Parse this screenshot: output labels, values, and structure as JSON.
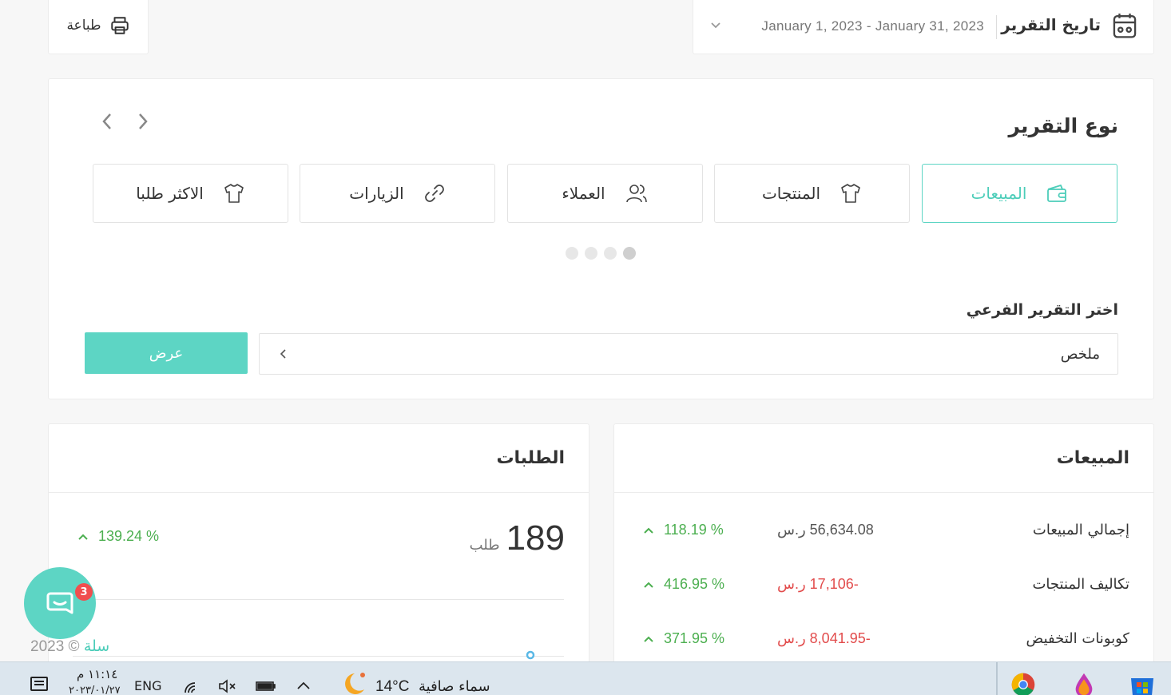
{
  "toolbar": {
    "print_label": "طباعة"
  },
  "date_filter": {
    "title": "تاريخ التقرير",
    "range": "January 1, 2023 - January 31, 2023"
  },
  "report_type": {
    "heading": "نوع التقرير",
    "tiles": [
      {
        "label": "المبيعات",
        "icon": "wallet-icon",
        "active": true
      },
      {
        "label": "المنتجات",
        "icon": "shirt-icon",
        "active": false
      },
      {
        "label": "العملاء",
        "icon": "users-icon",
        "active": false
      },
      {
        "label": "الزيارات",
        "icon": "link-icon",
        "active": false
      },
      {
        "label": "الاكثر طلبا",
        "icon": "shirt-icon",
        "active": false
      }
    ],
    "active_page": 4,
    "page_count": 4
  },
  "sub_report": {
    "label": "اختر التقرير الفرعي",
    "value": "ملخص",
    "show_button": "عرض"
  },
  "sales": {
    "title": "المبيعات",
    "rows": [
      {
        "label": "إجمالي المبيعات",
        "amount": "56,634.08 ر.س",
        "negative": false,
        "change": "118.19 %"
      },
      {
        "label": "تكاليف المنتجات",
        "amount": "-17,106 ر.س",
        "negative": true,
        "change": "416.95 %"
      },
      {
        "label": "كوبونات التخفيض",
        "amount": "-8,041.95 ر.س",
        "negative": true,
        "change": "371.95 %"
      }
    ]
  },
  "orders": {
    "title": "الطلبات",
    "count": "189",
    "unit": "طلب",
    "change": "139.24 %"
  },
  "chat": {
    "badge": "3"
  },
  "footer": {
    "copyright": "2023 ©",
    "brand": "سلة"
  },
  "taskbar": {
    "weather_text": "سماء صافية",
    "temperature": "14°C",
    "language": "ENG",
    "time": "١١:١٤ م",
    "date": "٢٠٢٣/٠١/٢٧"
  },
  "colors": {
    "accent": "#5dd5c4",
    "positive": "#4caf50",
    "negative": "#e24c4c"
  }
}
